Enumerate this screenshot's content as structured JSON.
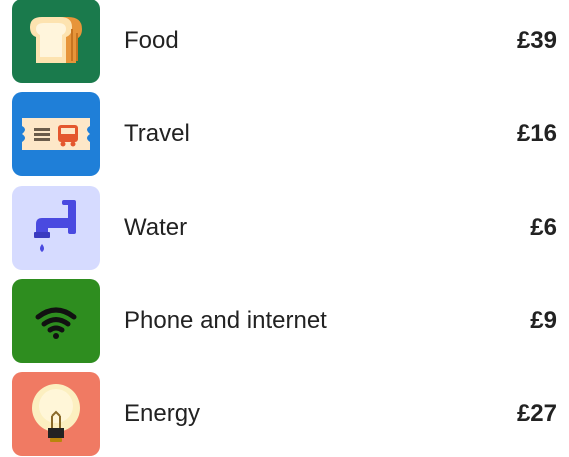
{
  "expenses": [
    {
      "icon": "bread-icon",
      "label": "Food",
      "amount": "£39",
      "tile_color": "#1a7a4c"
    },
    {
      "icon": "ticket-icon",
      "label": "Travel",
      "amount": "£16",
      "tile_color": "#1f7fd8"
    },
    {
      "icon": "water-tap-icon",
      "label": "Water",
      "amount": "£6",
      "tile_color": "#d6dbff"
    },
    {
      "icon": "wifi-icon",
      "label": "Phone and internet",
      "amount": "£9",
      "tile_color": "#2e8d1f"
    },
    {
      "icon": "lightbulb-icon",
      "label": "Energy",
      "amount": "£27",
      "tile_color": "#f07a63"
    }
  ]
}
